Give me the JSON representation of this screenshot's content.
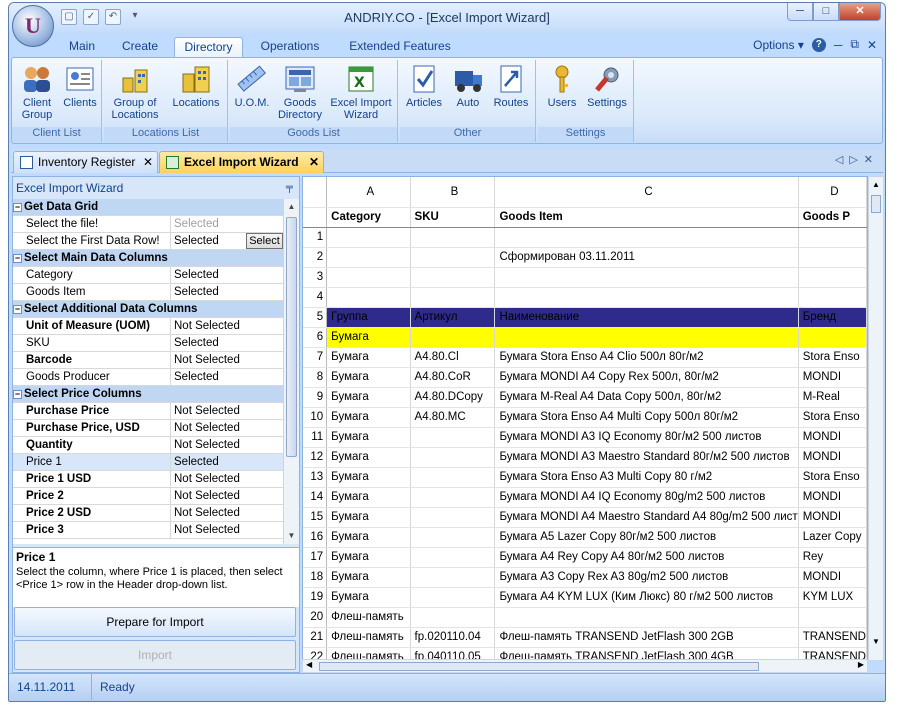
{
  "window": {
    "title": "ANDRIY.CO - [Excel Import Wizard]",
    "logo_letter": "U"
  },
  "ribbon_tabs": [
    "Main",
    "Create",
    "Directory",
    "Operations",
    "Extended Features"
  ],
  "active_tab": "Directory",
  "options_label": "Options",
  "groups": [
    {
      "label": "Client List",
      "buttons": [
        "Client\nGroup",
        "Clients"
      ]
    },
    {
      "label": "Locations List",
      "buttons": [
        "Group of\nLocations",
        "Locations"
      ]
    },
    {
      "label": "Goods List",
      "buttons": [
        "U.O.M.",
        "Goods\nDirectory",
        "Excel Import\nWizard"
      ]
    },
    {
      "label": "Other",
      "buttons": [
        "Articles",
        "Auto",
        "Routes"
      ]
    },
    {
      "label": "Settings",
      "buttons": [
        "Users",
        "Settings"
      ]
    }
  ],
  "doc_tabs": [
    "Inventory Register",
    "Excel Import Wizard"
  ],
  "left_panel": {
    "title": "Excel Import Wizard",
    "rows": [
      {
        "t": "cat",
        "name": "Get Data Grid"
      },
      {
        "t": "row",
        "name": "Select the file!",
        "value": "Selected",
        "gray": true
      },
      {
        "t": "row",
        "name": "Select the First Data Row!",
        "value": "Selected",
        "button": "Select"
      },
      {
        "t": "cat",
        "name": "Select Main Data Columns"
      },
      {
        "t": "row",
        "name": "Category",
        "value": "Selected"
      },
      {
        "t": "row",
        "name": "Goods Item",
        "value": "Selected"
      },
      {
        "t": "cat",
        "name": "Select Additional Data Columns"
      },
      {
        "t": "row",
        "name": "Unit of Measure (UOM)",
        "value": "Not Selected",
        "bold": true
      },
      {
        "t": "row",
        "name": "SKU",
        "value": "Selected"
      },
      {
        "t": "row",
        "name": "Barcode",
        "value": "Not Selected",
        "bold": true
      },
      {
        "t": "row",
        "name": "Goods Producer",
        "value": "Selected"
      },
      {
        "t": "cat",
        "name": "Select Price Columns"
      },
      {
        "t": "row",
        "name": "Purchase Price",
        "value": "Not Selected",
        "bold": true
      },
      {
        "t": "row",
        "name": "Purchase Price, USD",
        "value": "Not Selected",
        "bold": true
      },
      {
        "t": "row",
        "name": "Quantity",
        "value": "Not Selected",
        "bold": true
      },
      {
        "t": "row",
        "name": "Price 1",
        "value": "Selected",
        "sel": true
      },
      {
        "t": "row",
        "name": "Price 1 USD",
        "value": "Not Selected",
        "bold": true
      },
      {
        "t": "row",
        "name": "Price 2",
        "value": "Not Selected",
        "bold": true
      },
      {
        "t": "row",
        "name": "Price 2 USD",
        "value": "Not Selected",
        "bold": true
      },
      {
        "t": "row",
        "name": "Price 3",
        "value": "Not Selected",
        "bold": true
      }
    ],
    "desc_title": "Price 1",
    "desc_text": "Select the column, where Price 1 is placed, then select <Price 1> row in the Header drop-down list.",
    "prepare_label": "Prepare for Import",
    "import_label": "Import"
  },
  "grid": {
    "col_letters": [
      "A",
      "B",
      "C",
      "D"
    ],
    "headers": [
      "Category",
      "SKU",
      "Goods Item",
      "Goods P"
    ],
    "rows": [
      {
        "n": "1",
        "c": [
          "",
          "",
          "",
          ""
        ]
      },
      {
        "n": "2",
        "c": [
          "",
          "",
          "Сформирован 03.11.2011",
          ""
        ]
      },
      {
        "n": "3",
        "c": [
          "",
          "",
          "",
          ""
        ]
      },
      {
        "n": "4",
        "c": [
          "",
          "",
          "",
          ""
        ]
      },
      {
        "n": "5",
        "c": [
          "Группа",
          "Артикул",
          "Наименование",
          "Бренд"
        ],
        "style": "blue"
      },
      {
        "n": "6",
        "c": [
          "Бумага",
          "",
          "",
          ""
        ],
        "style": "yel"
      },
      {
        "n": "7",
        "c": [
          "Бумага",
          "A4.80.Cl",
          "Бумага Stora Enso A4 Clio 500л 80г/м2",
          "Stora Enso"
        ]
      },
      {
        "n": "8",
        "c": [
          "Бумага",
          "A4.80.CoR",
          "Бумага MONDI A4 Copy Rex 500л, 80г/м2",
          "MONDI"
        ]
      },
      {
        "n": "9",
        "c": [
          "Бумага",
          "A4.80.DCopy",
          "Бумага M-Real A4 Data Copy 500л, 80г/м2",
          "M-Real"
        ]
      },
      {
        "n": "10",
        "c": [
          "Бумага",
          "A4.80.MC",
          "Бумага Stora Enso A4 Multi Copy 500л 80г/м2",
          "Stora Enso"
        ]
      },
      {
        "n": "11",
        "c": [
          "Бумага",
          "",
          "Бумага MONDI A3 IQ Economy 80г/м2 500 листов",
          "MONDI"
        ]
      },
      {
        "n": "12",
        "c": [
          "Бумага",
          "",
          "Бумага MONDI A3 Maestro Standard 80г/м2 500 листов",
          "MONDI"
        ]
      },
      {
        "n": "13",
        "c": [
          "Бумага",
          "",
          "Бумага Stora Enso A3 Multi Copy 80 г/м2",
          "Stora Enso"
        ]
      },
      {
        "n": "14",
        "c": [
          "Бумага",
          "",
          "Бумага MONDI A4 IQ Economy 80g/m2 500 листов",
          "MONDI"
        ]
      },
      {
        "n": "15",
        "c": [
          "Бумага",
          "",
          "Бумага MONDI A4 Maestro Standard A4 80g/m2 500 лист",
          "MONDI"
        ]
      },
      {
        "n": "16",
        "c": [
          "Бумага",
          "",
          "Бумага A5 Lazer Copy 80г/м2 500 листов",
          "Lazer Copy"
        ]
      },
      {
        "n": "17",
        "c": [
          "Бумага",
          "",
          "Бумага A4 Rey Copy A4 80г/м2 500 листов",
          "Rey"
        ]
      },
      {
        "n": "18",
        "c": [
          "Бумага",
          "",
          "Бумага A3 Copy Rex A3 80g/m2 500 листов",
          "MONDI"
        ]
      },
      {
        "n": "19",
        "c": [
          "Бумага",
          "",
          "Бумага A4 KYM LUX (Ким Люкс) 80 г/м2 500 листов",
          "KYM LUX"
        ]
      },
      {
        "n": "20",
        "c": [
          "Флеш-память",
          "",
          "",
          ""
        ]
      },
      {
        "n": "21",
        "c": [
          "Флеш-память",
          "fp.020110.04",
          "Флеш-память TRANSEND JetFlash 300 2GB",
          "TRANSEND"
        ]
      },
      {
        "n": "22",
        "c": [
          "Флеш-память",
          "fp.040110.05",
          "Флеш-память TRANSEND JetFlash 300 4GB",
          "TRANSEND"
        ]
      }
    ]
  },
  "status": {
    "date": "14.11.2011",
    "state": "Ready"
  }
}
